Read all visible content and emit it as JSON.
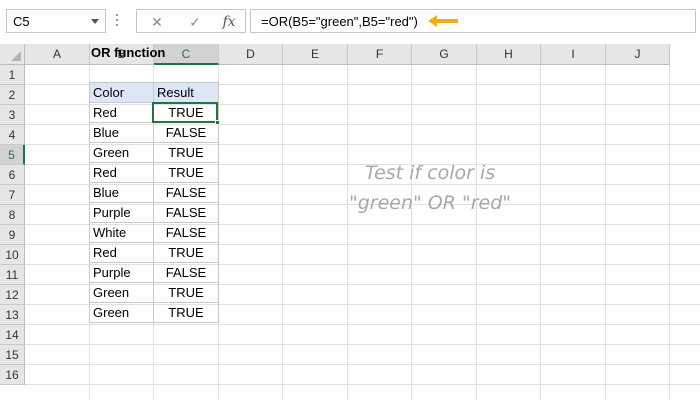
{
  "formula_bar": {
    "name_box": "C5",
    "cancel_glyph": "✕",
    "enter_glyph": "✓",
    "fx_label": "fx",
    "formula": "=OR(B5=\"green\",B5=\"red\")",
    "arrow_color": "#f0ad1e",
    "icons": [
      "chevron-down-icon",
      "close-icon",
      "check-icon",
      "function-icon",
      "arrow-left-icon"
    ]
  },
  "sheet": {
    "columns": [
      "A",
      "B",
      "C",
      "D",
      "E",
      "F",
      "G",
      "H",
      "I",
      "J"
    ],
    "rows": [
      "1",
      "2",
      "3",
      "4",
      "5",
      "6",
      "7",
      "8",
      "9",
      "10",
      "11",
      "12",
      "13",
      "14",
      "15",
      "16"
    ],
    "selected_column": "C",
    "selected_row": "5",
    "title": "OR function",
    "table": {
      "headers": [
        "Color",
        "Result"
      ],
      "rows": [
        [
          "Red",
          "TRUE"
        ],
        [
          "Blue",
          "FALSE"
        ],
        [
          "Green",
          "TRUE"
        ],
        [
          "Red",
          "TRUE"
        ],
        [
          "Blue",
          "FALSE"
        ],
        [
          "Purple",
          "FALSE"
        ],
        [
          "White",
          "FALSE"
        ],
        [
          "Red",
          "TRUE"
        ],
        [
          "Purple",
          "FALSE"
        ],
        [
          "Green",
          "TRUE"
        ],
        [
          "Green",
          "TRUE"
        ]
      ]
    },
    "annotation_line1": "Test if color is",
    "annotation_line2": "\"green\" OR \"red\"",
    "accent_color": "#217346",
    "header_fill": "#dde6f5"
  }
}
